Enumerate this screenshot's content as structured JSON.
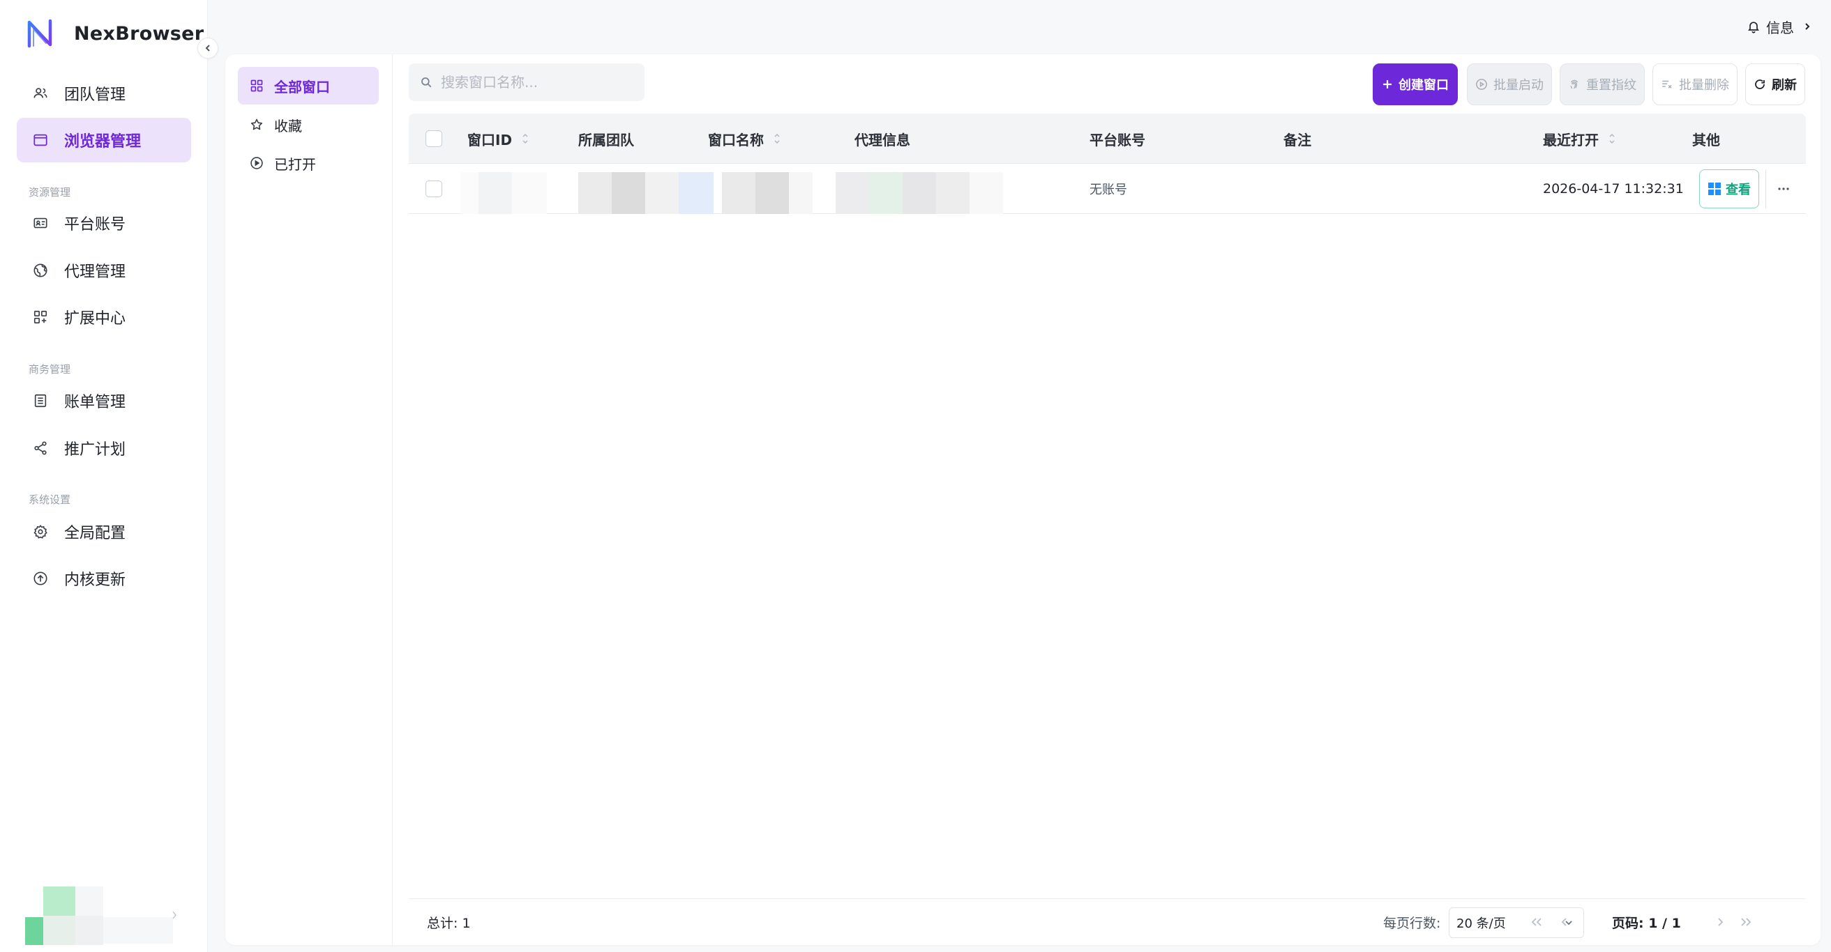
{
  "app": {
    "name": "NexBrowser",
    "accent": "#6d28d9"
  },
  "sidebar": {
    "items": [
      {
        "label": "团队管理",
        "icon": "users-icon"
      },
      {
        "label": "浏览器管理",
        "icon": "window-icon",
        "active": true
      }
    ],
    "sections": [
      {
        "title": "资源管理",
        "items": [
          {
            "label": "平台账号",
            "icon": "id-card-icon"
          },
          {
            "label": "代理管理",
            "icon": "globe-icon"
          },
          {
            "label": "扩展中心",
            "icon": "extensions-icon"
          }
        ]
      },
      {
        "title": "商务管理",
        "items": [
          {
            "label": "账单管理",
            "icon": "bill-icon"
          },
          {
            "label": "推广计划",
            "icon": "share-icon"
          }
        ]
      },
      {
        "title": "系统设置",
        "items": [
          {
            "label": "全局配置",
            "icon": "gear-icon"
          },
          {
            "label": "内核更新",
            "icon": "upgrade-icon"
          }
        ]
      }
    ]
  },
  "header": {
    "notice_label": "信息"
  },
  "filters": [
    {
      "label": "全部窗口",
      "icon": "grid-icon",
      "active": true
    },
    {
      "label": "收藏",
      "icon": "star-icon"
    },
    {
      "label": "已打开",
      "icon": "play-circle-icon"
    }
  ],
  "search": {
    "placeholder": "搜索窗口名称..."
  },
  "toolbar": {
    "create_label": "创建窗口",
    "batch_start_label": "批量启动",
    "reset_fingerprint_label": "重置指纹",
    "batch_delete_label": "批量删除",
    "refresh_label": "刷新"
  },
  "table": {
    "columns": [
      "窗口ID",
      "所属团队",
      "窗口名称",
      "代理信息",
      "平台账号",
      "备注",
      "最近打开",
      "其他"
    ],
    "rows": [
      {
        "platform_account": "无账号",
        "note": "",
        "last_opened": "2026-04-17 11:32:31",
        "view_label": "查看"
      }
    ]
  },
  "footer": {
    "total": "总计: 1",
    "rows_per_page_label": "每页行数:",
    "rows_per_page_value": "20 条/页",
    "page_label": "页码: 1 / 1"
  }
}
